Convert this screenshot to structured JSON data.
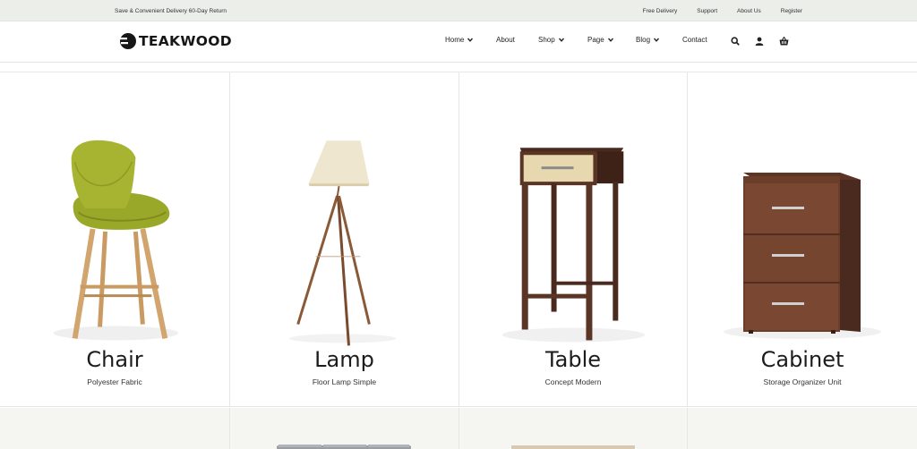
{
  "topbar": {
    "promo": "Save & Convenient Delivery 60-Day Return",
    "links": [
      "Free Delivery",
      "Support",
      "About Us",
      "Register"
    ]
  },
  "header": {
    "logo_text": "TEAKWOOD",
    "nav": [
      {
        "label": "Home",
        "dropdown": true
      },
      {
        "label": "About",
        "dropdown": false
      },
      {
        "label": "Shop",
        "dropdown": true
      },
      {
        "label": "Page",
        "dropdown": true
      },
      {
        "label": "Blog",
        "dropdown": true
      },
      {
        "label": "Contact",
        "dropdown": false
      }
    ],
    "icons": [
      "search-icon",
      "user-icon",
      "basket-icon"
    ]
  },
  "products": [
    {
      "name": "Chair",
      "subtitle": "Polyester Fabric"
    },
    {
      "name": "Lamp",
      "subtitle": "Floor Lamp Simple"
    },
    {
      "name": "Table",
      "subtitle": "Concept Modern"
    },
    {
      "name": "Cabinet",
      "subtitle": "Storage Organizer Unit"
    }
  ],
  "colors": {
    "topbar_bg": "#eceeea",
    "chair_seat": "#9aa82a",
    "wood_light": "#c99a62",
    "wood_dark": "#5a3425",
    "drawer_front": "#e8d8b0",
    "cabinet": "#6b3e2a"
  }
}
